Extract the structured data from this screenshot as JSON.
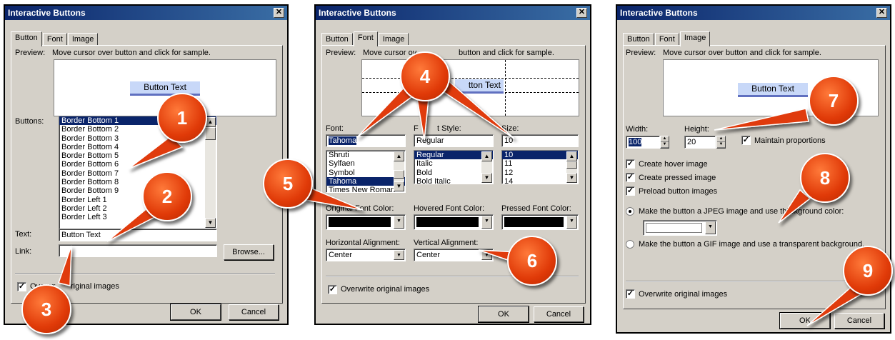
{
  "window_title": "Interactive Buttons",
  "close_glyph": "✕",
  "tabs": [
    "Button",
    "Font",
    "Image"
  ],
  "preview_label": "Preview:",
  "preview_text": "Move cursor over button and click for sample.",
  "preview_partial": "Move cursor ov",
  "preview_partial2": "button and click for sample.",
  "button_text": "Button Text",
  "button_text_partial": "tton Text",
  "dialog1": {
    "buttons_label": "Buttons:",
    "buttons_list": [
      "Border Bottom 1",
      "Border Bottom 2",
      "Border Bottom 3",
      "Border Bottom 4",
      "Border Bottom 5",
      "Border Bottom 6",
      "Border Bottom 7",
      "Border Bottom 8",
      "Border Bottom 9",
      "Border Left 1",
      "Border Left 2",
      "Border Left 3"
    ],
    "text_label": "Text:",
    "text_value": "Button Text",
    "link_label": "Link:",
    "link_value": "",
    "browse_label": "Browse...",
    "overwrite_label_a": "Overwr",
    "overwrite_label_b": "riginal images",
    "ok_label": "OK",
    "cancel_label": "Cancel"
  },
  "dialog2": {
    "font_label": "Font:",
    "font_value": "Tahoma",
    "font_list": [
      "Shruti",
      "Sylfaen",
      "Symbol",
      "Tahoma",
      "Times New Roman"
    ],
    "style_label_a": "F",
    "style_label_b": "t Style:",
    "style_value_a": "R",
    "style_value_b": "egular",
    "style_list": [
      "Regular",
      "Italic",
      "Bold",
      "Bold Italic"
    ],
    "size_label": "Size:",
    "size_value": "10",
    "size_list": [
      "10",
      "11",
      "12",
      "14"
    ],
    "original_color_label": "Original Font Color:",
    "hovered_color_label": "Hovered Font Color:",
    "pressed_color_label": "Pressed Font Color:",
    "halign_label": "Horizontal Alignment:",
    "halign_value": "Center",
    "valign_label": "Vertical Alignment:",
    "valign_value": "Center",
    "overwrite_label": "Overwrite original images",
    "ok_label": "OK",
    "cancel_label": "Cancel"
  },
  "dialog3": {
    "width_label": "Width:",
    "width_value": "100",
    "height_label": "Height:",
    "height_value": "20",
    "maintain_label": "Maintain proportions",
    "create_hover_label": "Create hover image",
    "create_pressed_label": "Create pressed image",
    "preload_label": "Preload button images",
    "jpeg_label_a": "Make the button a JPEG image and use thi",
    "jpeg_label_b": "ackground color:",
    "gif_label": "Make the button a GIF image and use a transparent background.",
    "overwrite_label": "Overwrite original images",
    "ok_label": "OK",
    "cancel_label": "Cancel"
  },
  "callouts": [
    "1",
    "2",
    "3",
    "4",
    "5",
    "6",
    "7",
    "8",
    "9"
  ],
  "colors": {
    "title_bar": "#0a246a",
    "selection": "#0a246a",
    "callout": "#e03a08",
    "dialog_bg": "#d4d0c8"
  }
}
